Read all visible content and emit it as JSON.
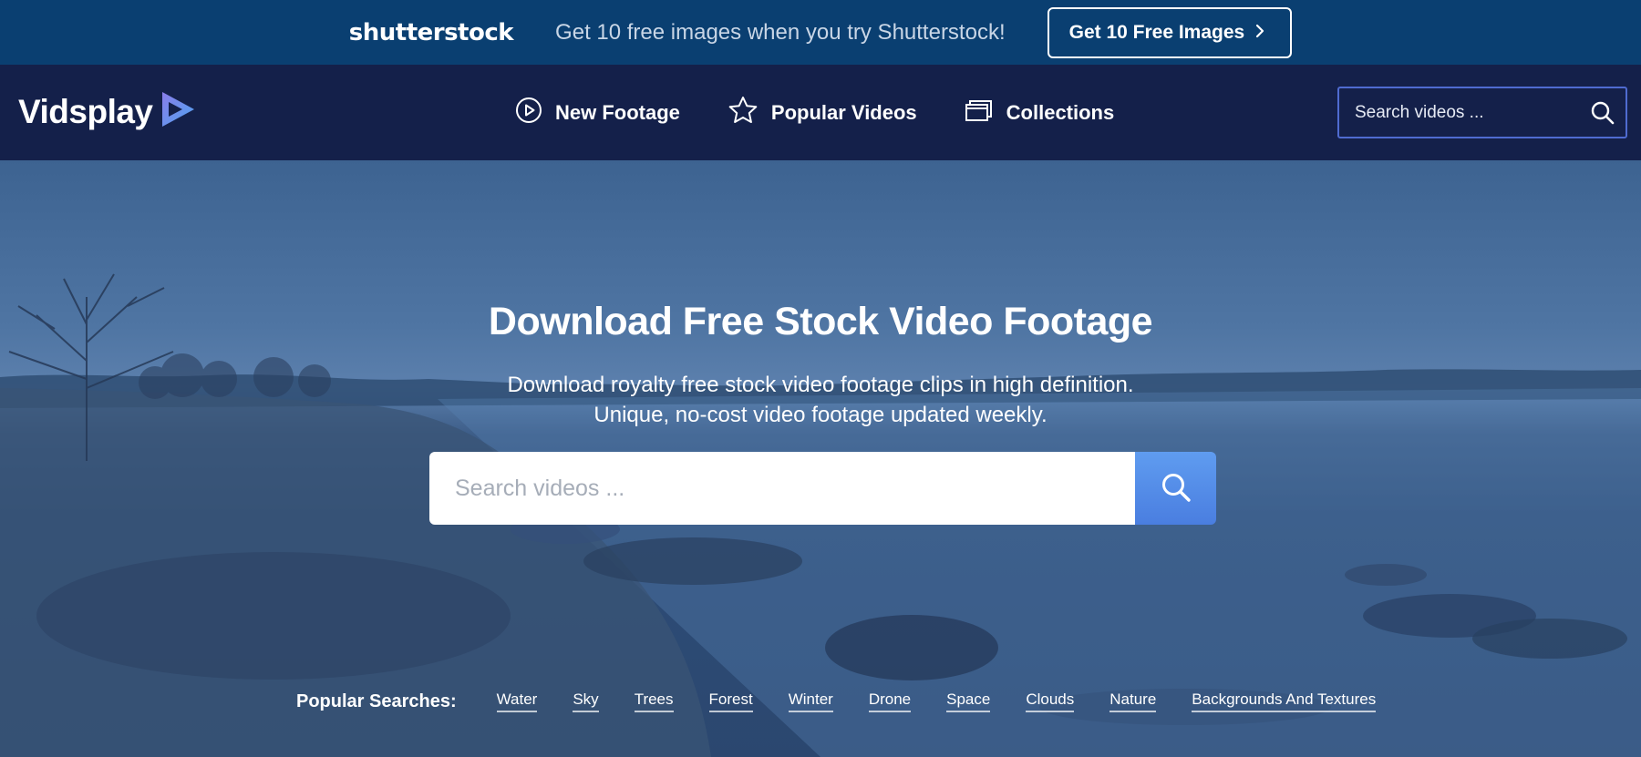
{
  "promo": {
    "brand": "shutterstock",
    "text": "Get 10 free images when you try Shutterstock!",
    "button_label": "Get 10 Free Images"
  },
  "nav": {
    "logo_text": "Vidsplay",
    "items": [
      {
        "label": "New Footage",
        "icon": "play-circle-icon"
      },
      {
        "label": "Popular Videos",
        "icon": "star-icon"
      },
      {
        "label": "Collections",
        "icon": "collections-icon"
      }
    ],
    "search_placeholder": "Search videos ..."
  },
  "hero": {
    "title": "Download Free Stock Video Footage",
    "subtitle_line1": "Download royalty free stock video footage clips in high definition.",
    "subtitle_line2": "Unique, no-cost video footage updated weekly.",
    "search_placeholder": "Search videos ...",
    "popular_label": "Popular Searches:",
    "popular_tags": [
      "Water",
      "Sky",
      "Trees",
      "Forest",
      "Winter",
      "Drone",
      "Space",
      "Clouds",
      "Nature",
      "Backgrounds And Textures"
    ]
  },
  "colors": {
    "promo_bg": "#0a3f71",
    "nav_bg": "#14204a",
    "accent": "#4a7ee0",
    "logo_play": "#6b7fe8"
  }
}
